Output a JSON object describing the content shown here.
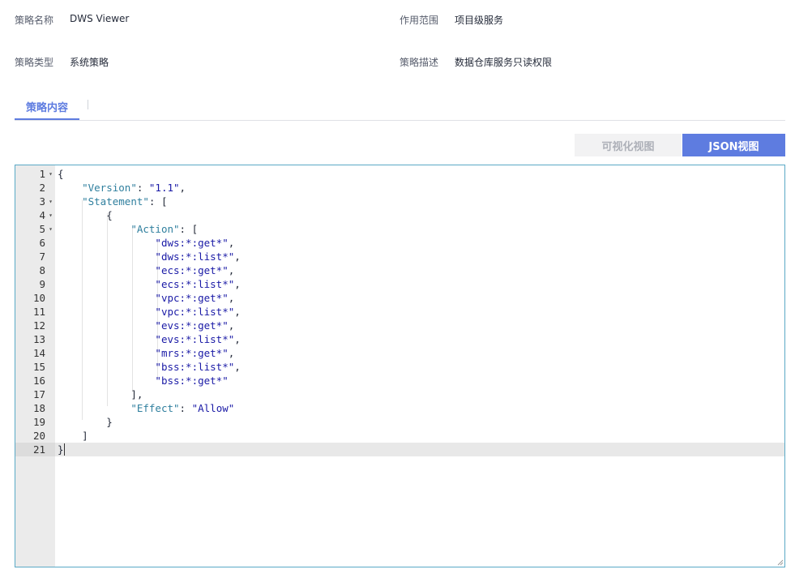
{
  "policy": {
    "name_label": "策略名称",
    "name_value": "DWS Viewer",
    "scope_label": "作用范围",
    "scope_value": "项目级服务",
    "type_label": "策略类型",
    "type_value": "系统策略",
    "desc_label": "策略描述",
    "desc_value": "数据仓库服务只读权限"
  },
  "tabs": {
    "content": "策略内容"
  },
  "view_buttons": {
    "visual": "可视化视图",
    "json": "JSON视图"
  },
  "editor": {
    "active_line": 21,
    "lines": [
      {
        "num": "1",
        "fold": true,
        "indent": "",
        "key": "",
        "sep": "",
        "str": "",
        "tail": "{"
      },
      {
        "num": "2",
        "fold": false,
        "indent": "    ",
        "key": "\"Version\"",
        "sep": ": ",
        "str": "\"1.1\"",
        "tail": ","
      },
      {
        "num": "3",
        "fold": true,
        "indent": "    ",
        "key": "\"Statement\"",
        "sep": ": ",
        "str": "",
        "tail": "["
      },
      {
        "num": "4",
        "fold": true,
        "indent": "        ",
        "key": "",
        "sep": "",
        "str": "",
        "tail": "{"
      },
      {
        "num": "5",
        "fold": true,
        "indent": "            ",
        "key": "\"Action\"",
        "sep": ": ",
        "str": "",
        "tail": "["
      },
      {
        "num": "6",
        "fold": false,
        "indent": "                ",
        "key": "",
        "sep": "",
        "str": "\"dws:*:get*\"",
        "tail": ","
      },
      {
        "num": "7",
        "fold": false,
        "indent": "                ",
        "key": "",
        "sep": "",
        "str": "\"dws:*:list*\"",
        "tail": ","
      },
      {
        "num": "8",
        "fold": false,
        "indent": "                ",
        "key": "",
        "sep": "",
        "str": "\"ecs:*:get*\"",
        "tail": ","
      },
      {
        "num": "9",
        "fold": false,
        "indent": "                ",
        "key": "",
        "sep": "",
        "str": "\"ecs:*:list*\"",
        "tail": ","
      },
      {
        "num": "10",
        "fold": false,
        "indent": "                ",
        "key": "",
        "sep": "",
        "str": "\"vpc:*:get*\"",
        "tail": ","
      },
      {
        "num": "11",
        "fold": false,
        "indent": "                ",
        "key": "",
        "sep": "",
        "str": "\"vpc:*:list*\"",
        "tail": ","
      },
      {
        "num": "12",
        "fold": false,
        "indent": "                ",
        "key": "",
        "sep": "",
        "str": "\"evs:*:get*\"",
        "tail": ","
      },
      {
        "num": "13",
        "fold": false,
        "indent": "                ",
        "key": "",
        "sep": "",
        "str": "\"evs:*:list*\"",
        "tail": ","
      },
      {
        "num": "14",
        "fold": false,
        "indent": "                ",
        "key": "",
        "sep": "",
        "str": "\"mrs:*:get*\"",
        "tail": ","
      },
      {
        "num": "15",
        "fold": false,
        "indent": "                ",
        "key": "",
        "sep": "",
        "str": "\"bss:*:list*\"",
        "tail": ","
      },
      {
        "num": "16",
        "fold": false,
        "indent": "                ",
        "key": "",
        "sep": "",
        "str": "\"bss:*:get*\"",
        "tail": ""
      },
      {
        "num": "17",
        "fold": false,
        "indent": "            ",
        "key": "",
        "sep": "",
        "str": "",
        "tail": "],"
      },
      {
        "num": "18",
        "fold": false,
        "indent": "            ",
        "key": "\"Effect\"",
        "sep": ": ",
        "str": "\"Allow\"",
        "tail": ""
      },
      {
        "num": "19",
        "fold": false,
        "indent": "        ",
        "key": "",
        "sep": "",
        "str": "",
        "tail": "}"
      },
      {
        "num": "20",
        "fold": false,
        "indent": "    ",
        "key": "",
        "sep": "",
        "str": "",
        "tail": "]"
      },
      {
        "num": "21",
        "fold": false,
        "indent": "",
        "key": "",
        "sep": "",
        "str": "",
        "tail": "}"
      }
    ]
  },
  "colors": {
    "accent": "#5e7ce0",
    "editor_border": "#5aa9c6",
    "key": "#2f7f9e",
    "string": "#1a1aa6"
  }
}
